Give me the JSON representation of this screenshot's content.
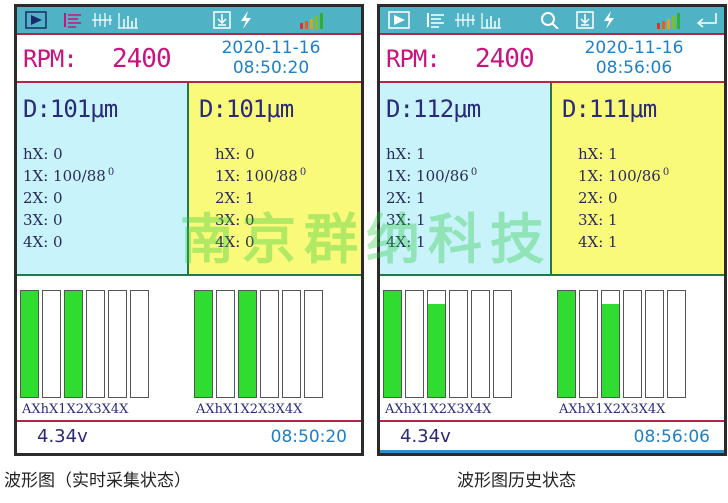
{
  "screens": [
    {
      "rpm_label": "RPM:",
      "rpm_value": "2400",
      "date": "2020-11-16",
      "time": "08:50:20",
      "left": {
        "d": "D:101μm",
        "hx": "hX: 0",
        "x1": "1X: 100/88",
        "x1_sup": "0",
        "x2": "2X: 0",
        "x3": "3X: 0",
        "x4": "4X: 0"
      },
      "right": {
        "d": "D:101μm",
        "hx": "hX: 0",
        "x1": "1X: 100/88",
        "x1_sup": "0",
        "x2": "2X: 1",
        "x3": "3X: 0",
        "x4": "4X: 0"
      },
      "bar_labels": [
        "AXhX1X2X3X4X",
        "AXhX1X2X3X4X"
      ],
      "bars_left": [
        1.0,
        0.0,
        1.0,
        0.0,
        0.0,
        0.0
      ],
      "bars_right": [
        1.0,
        0.0,
        1.0,
        0.0,
        0.0,
        0.0
      ],
      "voltage": "4.34v",
      "status_time": "08:50:20",
      "caption": "波形图（实时采集状态）"
    },
    {
      "rpm_label": "RPM:",
      "rpm_value": "2400",
      "date": "2020-11-16",
      "time": "08:56:06",
      "left": {
        "d": "D:112μm",
        "hx": "hX: 1",
        "x1": "1X: 100/86",
        "x1_sup": "0",
        "x2": "2X: 1",
        "x3": "3X: 1",
        "x4": "4X: 1"
      },
      "right": {
        "d": "D:111μm",
        "hx": "hX: 1",
        "x1": "1X: 100/86",
        "x1_sup": "0",
        "x2": "2X: 0",
        "x3": "3X: 1",
        "x4": "4X: 1"
      },
      "bar_labels": [
        "AXhX1X2X3X4X",
        "AXhX1X2X3X4X"
      ],
      "bars_left": [
        1.0,
        0.0,
        0.88,
        0.0,
        0.0,
        0.0
      ],
      "bars_right": [
        1.0,
        0.0,
        0.88,
        0.0,
        0.0,
        0.0
      ],
      "voltage": "4.34v",
      "status_time": "08:56:06",
      "caption": "波形图历史状态"
    }
  ],
  "watermark": "南京群纳科技",
  "icons": [
    "play-icon",
    "list-icon",
    "wave-icon",
    "bar-chart-icon",
    "search-icon",
    "save-icon",
    "power-icon",
    "signal-icon",
    "return-icon"
  ],
  "colors": {
    "topbar": "#4fb3c5",
    "cyan_panel": "#c8f3fb",
    "yellow_panel": "#fafa7a",
    "bar_fill": "#2fdc2f",
    "rpm": "#c8147f",
    "time": "#1f7fc7"
  }
}
